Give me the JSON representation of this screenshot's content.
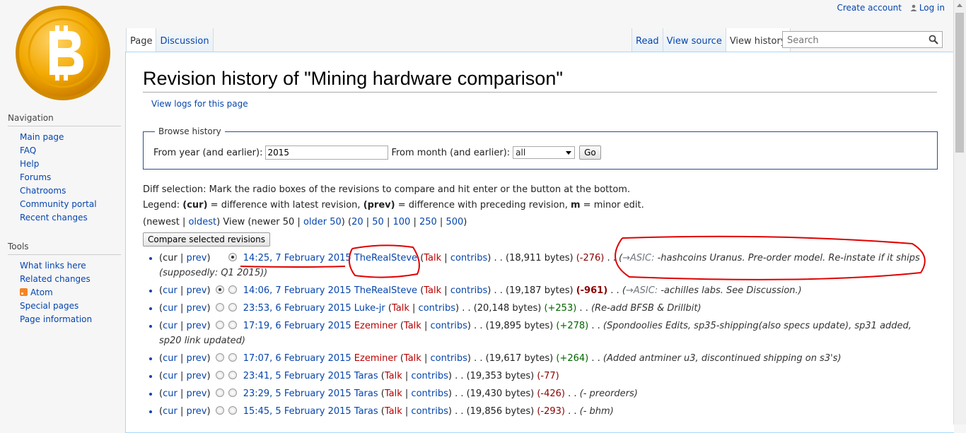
{
  "personal": {
    "create_account": "Create account",
    "login": "Log in"
  },
  "tabs_left": [
    {
      "label": "Page"
    },
    {
      "label": "Discussion"
    }
  ],
  "tabs_right": [
    {
      "label": "Read"
    },
    {
      "label": "View source"
    },
    {
      "label": "View history"
    }
  ],
  "search": {
    "placeholder": "Search"
  },
  "sidebar": {
    "navigation": {
      "title": "Navigation",
      "items": [
        "Main page",
        "FAQ",
        "Help",
        "Forums",
        "Chatrooms",
        "Community portal",
        "Recent changes"
      ]
    },
    "tools": {
      "title": "Tools",
      "items": [
        "What links here",
        "Related changes",
        "Atom",
        "Special pages",
        "Page information"
      ]
    }
  },
  "page": {
    "title": "Revision history of \"Mining hardware comparison\"",
    "view_logs": "View logs for this page"
  },
  "browse": {
    "legend": "Browse history",
    "year_label": "From year (and earlier):",
    "year_value": "2015",
    "month_label": "From month (and earlier):",
    "month_value": "all",
    "go": "Go"
  },
  "help": {
    "line1": "Diff selection: Mark the radio boxes of the revisions to compare and hit enter or the button at the bottom.",
    "legend_prefix": "Legend: ",
    "cur": "(cur)",
    "cur_desc": " = difference with latest revision, ",
    "prev": "(prev)",
    "prev_desc": " = difference with preceding revision, ",
    "m": "m",
    "m_desc": " = minor edit."
  },
  "nav": {
    "prefix": "(newest | ",
    "oldest": "oldest",
    "mid": ") View (newer 50 | ",
    "older": "older 50",
    "paren": ") (",
    "sizes": [
      "20",
      "50",
      "100",
      "250",
      "500"
    ],
    "close": ")"
  },
  "compare_button": "Compare selected revisions",
  "revisions": [
    {
      "date": "14:25, 7 February 2015",
      "user": "TheRealSteve",
      "user_red": false,
      "bytes": "(18,911 bytes)",
      "diff": "(-276)",
      "diff_class": "neg",
      "section": "→ASIC:",
      "comment": " -hashcoins Uranus. Pre-order model. Re-instate if it ships (supposedly: Q1 2015))",
      "radio1": "hidden",
      "radio2": "checked",
      "cur": "cur",
      "prev": "prev",
      "cur_link": false
    },
    {
      "date": "14:06, 7 February 2015",
      "user": "TheRealSteve",
      "user_red": false,
      "bytes": "(19,187 bytes)",
      "diff": "(-961)",
      "diff_class": "neg-big",
      "section": "→ASIC:",
      "comment": " -achilles labs. See Discussion.)",
      "radio1": "checked",
      "radio2": "",
      "cur": "cur",
      "prev": "prev",
      "cur_link": true
    },
    {
      "date": "23:53, 6 February 2015",
      "user": "Luke-jr",
      "user_red": false,
      "bytes": "(20,148 bytes)",
      "diff": "(+253)",
      "diff_class": "pos",
      "section": "",
      "comment": "(Re-add BFSB & Drillbit)",
      "radio1": "",
      "radio2": "",
      "cur": "cur",
      "prev": "prev",
      "cur_link": true
    },
    {
      "date": "17:19, 6 February 2015",
      "user": "Ezeminer",
      "user_red": true,
      "bytes": "(19,895 bytes)",
      "diff": "(+278)",
      "diff_class": "pos",
      "section": "",
      "comment": "(Spondoolies Edits, sp35-shipping(also specs update), sp31 added, sp20 link updated)",
      "radio1": "",
      "radio2": "",
      "cur": "cur",
      "prev": "prev",
      "cur_link": true
    },
    {
      "date": "17:07, 6 February 2015",
      "user": "Ezeminer",
      "user_red": true,
      "bytes": "(19,617 bytes)",
      "diff": "(+264)",
      "diff_class": "pos",
      "section": "",
      "comment": "(Added antminer u3, discontinued shipping on s3's)",
      "radio1": "",
      "radio2": "",
      "cur": "cur",
      "prev": "prev",
      "cur_link": true
    },
    {
      "date": "23:41, 5 February 2015",
      "user": "Taras",
      "user_red": false,
      "bytes": "(19,353 bytes)",
      "diff": "(-77)",
      "diff_class": "neg",
      "section": "",
      "comment": "",
      "radio1": "",
      "radio2": "",
      "cur": "cur",
      "prev": "prev",
      "cur_link": true
    },
    {
      "date": "23:29, 5 February 2015",
      "user": "Taras",
      "user_red": false,
      "bytes": "(19,430 bytes)",
      "diff": "(-426)",
      "diff_class": "neg",
      "section": "",
      "comment": "(- preorders)",
      "radio1": "",
      "radio2": "",
      "cur": "cur",
      "prev": "prev",
      "cur_link": true
    },
    {
      "date": "15:45, 5 February 2015",
      "user": "Taras",
      "user_red": false,
      "bytes": "(19,856 bytes)",
      "diff": "(-293)",
      "diff_class": "neg",
      "section": "",
      "comment": "(- bhm)",
      "radio1": "",
      "radio2": "",
      "cur": "cur",
      "prev": "prev",
      "cur_link": true
    }
  ],
  "talk": "Talk",
  "contribs": "contribs",
  "colors": {
    "link": "#0645ad",
    "redlink": "#ba0000",
    "border": "#a7d7f9",
    "annotation": "#e00000"
  }
}
